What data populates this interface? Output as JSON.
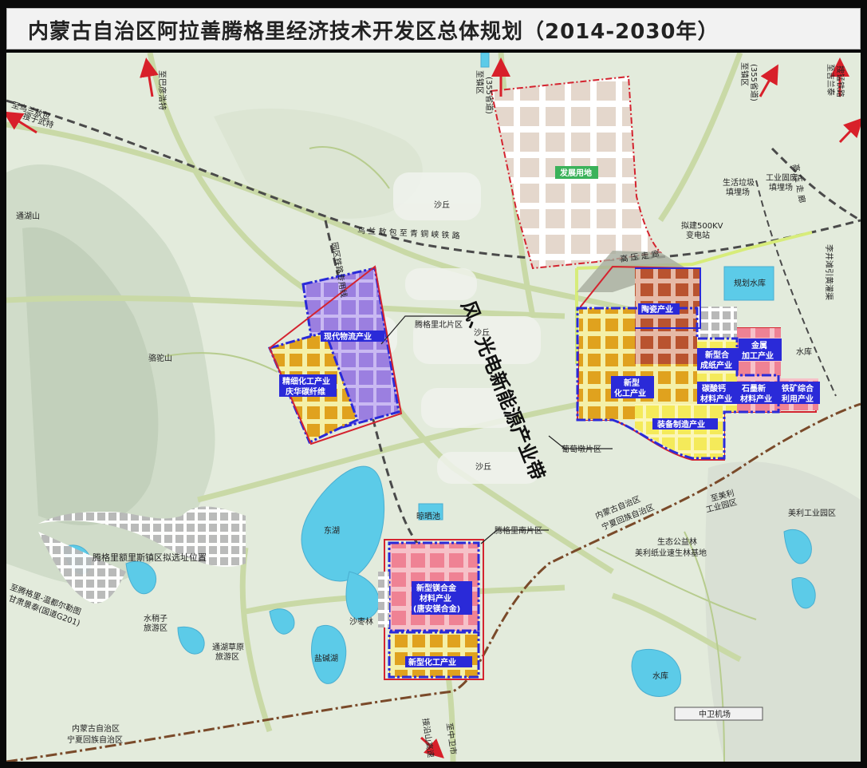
{
  "title": "内蒙古自治区阿拉善腾格里经济技术开发区总体规划（2014-2030年）",
  "colors": {
    "terrain": "#e3ebdc",
    "hills": "#cbd8c4",
    "water": "#5ccbe8",
    "road": "#c9d9a6",
    "purple_zone": "#9b7fe0",
    "orange_zone": "#e0a21e",
    "brown_zone": "#b9532f",
    "pink_zone": "#f08294",
    "yellow_zone": "#f4ea5a",
    "gray_zone": "#b8b8b8",
    "development": "#e4d7cc",
    "blue_outline": "#2a2ad8",
    "red_outline": "#d4232f",
    "railway": "#4a4a4a",
    "boundary": "#7a4a2a"
  },
  "place_labels": {
    "dongbo": "至乌兰敖包",
    "dongbo2": "搜于武特",
    "bayanhot": "至巴彦浩特",
    "zhenzhen": "至镇区",
    "zhenzhen_road": "(355省道)",
    "zhenzhen2": "至镇区",
    "zhenzhen2_road": "(355省道)",
    "wulan_rail": "至吉兰泰",
    "wulan_rail2": "搜锰铁路",
    "tonghu_mountain": "通湖山",
    "luotuo_mountain": "骆驼山",
    "shaqiu1": "沙丘",
    "shaqiu2": "沙丘",
    "shaqiu3": "沙丘",
    "railway_name": "乌  兰  敖  包  至  青  铜  峡  铁  路",
    "park_railway": "园区铁路专用线",
    "dev_land": "发展用地",
    "garbage": "生活垃圾",
    "garbage2": "填埋场",
    "industrial_waste": "工业固废",
    "industrial_waste2": "填埋场",
    "substation": "拟建500KV",
    "substation2": "变电站",
    "hv_corridor": "高  压  走  廊",
    "hv_corridor2": "高  压  走  廊",
    "reservoir_plan": "规划水库",
    "reservoir": "水库",
    "reservoir2": "水库",
    "lijing": "李井滩引黄灌渠",
    "north_area": "腾格里北片区",
    "grape_area": "葡萄墩片区",
    "south_area": "腾格里南片区",
    "wind_belt": "风、光电新能源产业带",
    "east_lake": "东湖",
    "sun_pond": "晾晒池",
    "shazao": "沙枣林",
    "salt_lake": "盐碱湖",
    "town_site": "腾格里额里斯镇区拟选址位置",
    "shuizhi": "水稍子",
    "shuizhi2": "旅游区",
    "grassland": "通湖草原",
    "grassland2": "旅游区",
    "road_wuhai": "至腾格里-温都尔勒图",
    "road_wuhai2": "甘肃景泰(国道G201)",
    "border_top": "内蒙古自治区",
    "border_bottom": "宁夏回族自治区",
    "border2_top": "内蒙古自治区",
    "border2_bottom": "宁夏回族自治区",
    "meili": "至美利",
    "meili2": "工业园区",
    "meili_park": "美利工业园区",
    "eco_forest": "生态公益林",
    "eco_forest2": "美利纸业速生林基地",
    "airport": "中卫机场",
    "highway": "接沿山高速",
    "zhongwei": "至中卫市"
  },
  "zone_labels": {
    "logistics": "现代物流产业",
    "fine_chem": "精细化工产业",
    "fine_chem2": "庆华碳纤维",
    "ceramics": "陶瓷产业",
    "new_chem": "新型",
    "new_chem2": "化工产业",
    "composite": "新型合",
    "composite2": "成纸产业",
    "metal": "金属",
    "metal2": "加工产业",
    "calcium": "碳酸钙",
    "calcium2": "材料产业",
    "graphite": "石墨新",
    "graphite2": "材料产业",
    "mining": "铁矿综合",
    "mining2": "利用产业",
    "equipment": "装备制造产业",
    "magnesium": "新型镁合金",
    "magnesium2": "材料产业",
    "magnesium3": "(唐安镁合金)",
    "south_chem": "新型化工产业"
  }
}
